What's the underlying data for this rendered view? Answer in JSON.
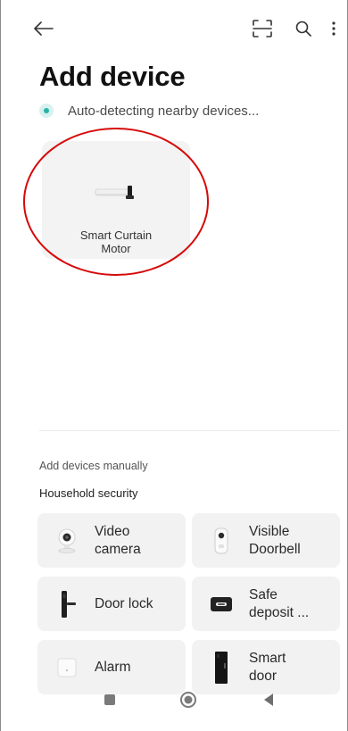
{
  "header": {
    "title": "Add device",
    "detect_status": "Auto-detecting nearby devices..."
  },
  "icons": {
    "back": "arrow-left-icon",
    "scan": "scan-icon",
    "search": "search-icon",
    "more": "more-vertical-icon"
  },
  "detected": [
    {
      "name": "Smart Curtain\nMotor",
      "icon": "curtain-motor-icon"
    }
  ],
  "manual": {
    "section_label": "Add devices manually",
    "category": "Household security",
    "devices": [
      {
        "label": "Video\ncamera",
        "icon": "video-camera-icon"
      },
      {
        "label": "Visible\nDoorbell",
        "icon": "doorbell-icon"
      },
      {
        "label": "Door lock",
        "icon": "door-lock-icon"
      },
      {
        "label": "Safe\ndeposit ...",
        "icon": "safe-icon"
      },
      {
        "label": "Alarm",
        "icon": "alarm-icon"
      },
      {
        "label": "Smart\ndoor",
        "icon": "smart-door-icon"
      }
    ]
  },
  "system_nav": [
    "recent-apps-icon",
    "home-icon",
    "back-triangle-icon"
  ],
  "colors": {
    "accent": "#27b3a7",
    "highlight": "#d60a0a",
    "card_bg": "#f2f2f2",
    "text": "#1a1a1a"
  }
}
